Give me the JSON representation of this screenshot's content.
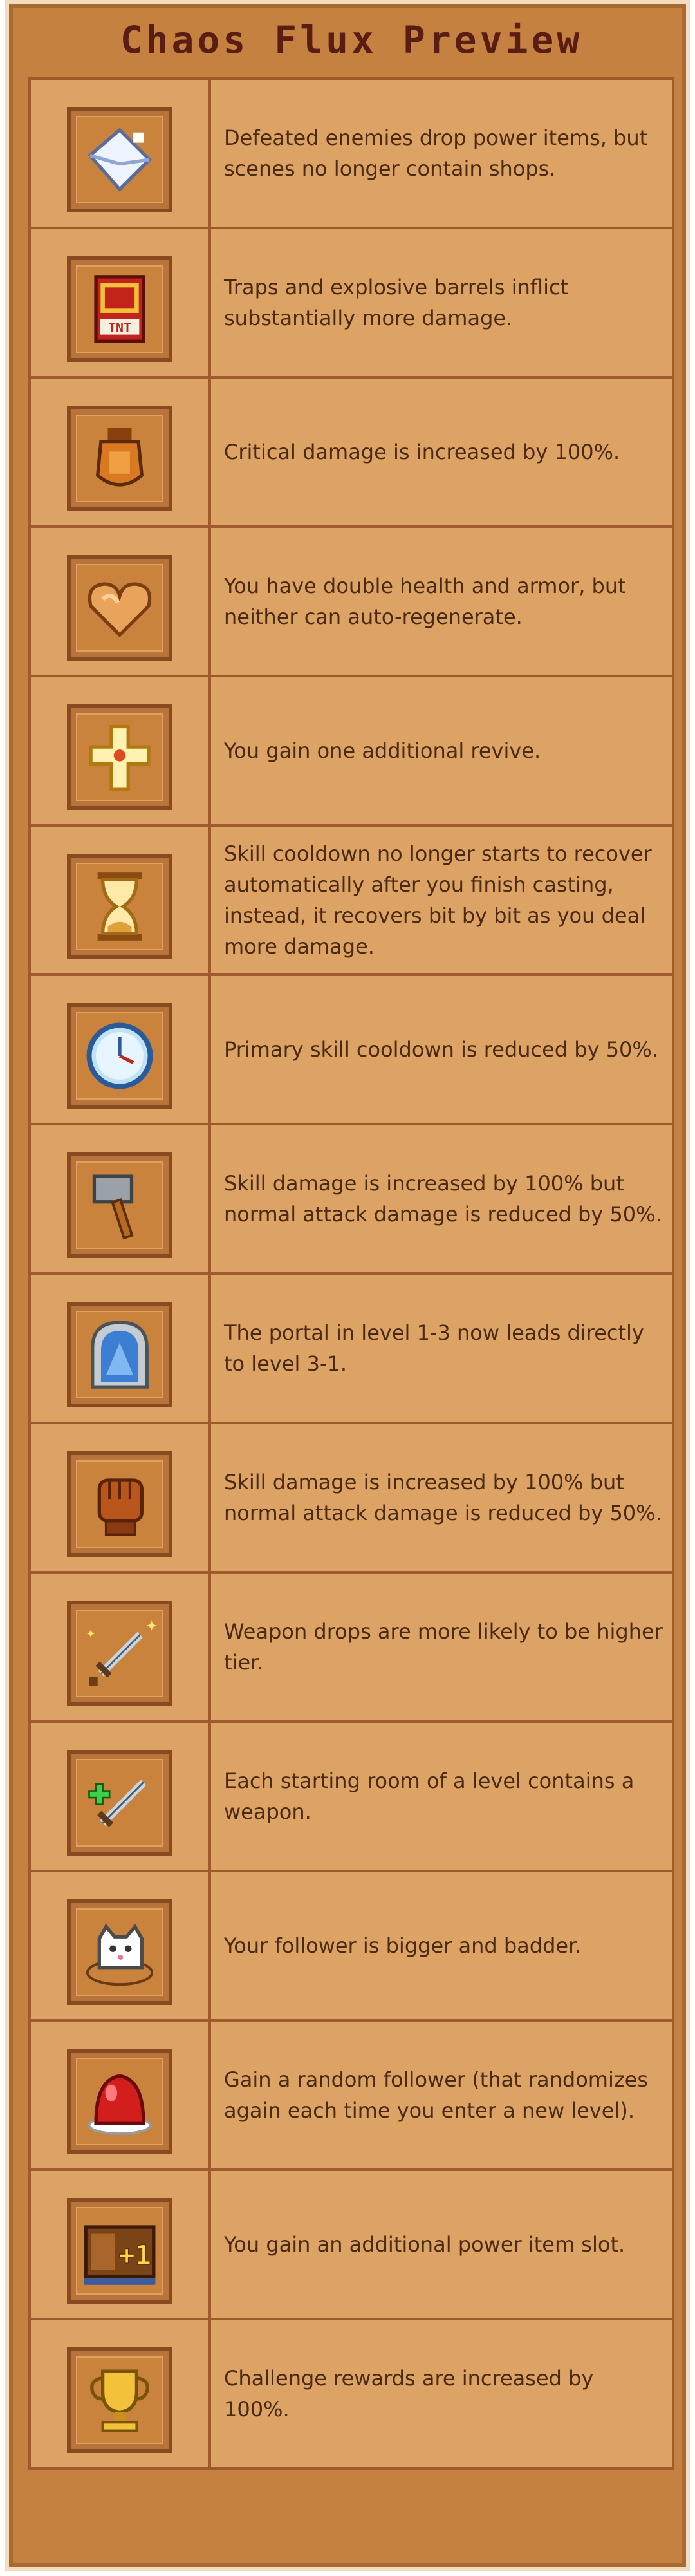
{
  "title": "Chaos Flux Preview",
  "rows": [
    {
      "icon": "envelope-icon",
      "text": "Defeated enemies drop power items, but scenes no longer contain shops."
    },
    {
      "icon": "tnt-icon",
      "text": "Traps and explosive barrels inflict substantially more damage."
    },
    {
      "icon": "shield-gauntlet-icon",
      "text": "Critical damage is increased by 100%."
    },
    {
      "icon": "heart-arm-icon",
      "text": "You have double health and armor, but neither can auto-regenerate."
    },
    {
      "icon": "holy-cross-icon",
      "text": "You gain one additional revive."
    },
    {
      "icon": "hourglass-icon",
      "text": "Skill cooldown no longer starts to recover automatically after you finish casting, instead, it recovers bit by bit as you deal more damage."
    },
    {
      "icon": "clock-icon",
      "text": "Primary skill cooldown is reduced by 50%."
    },
    {
      "icon": "hammer-icon",
      "text": "Skill damage is increased by 100% but normal attack damage is reduced by 50%."
    },
    {
      "icon": "portal-icon",
      "text": "The portal in level 1-3 now leads directly to level 3-1."
    },
    {
      "icon": "fist-icon",
      "text": "Skill damage is increased by 100% but normal attack damage is reduced by 50%."
    },
    {
      "icon": "sparkle-sword-icon",
      "text": "Weapon drops are more likely to be higher tier."
    },
    {
      "icon": "plus-sword-icon",
      "text": "Each starting room of a level contains a weapon."
    },
    {
      "icon": "cat-icon",
      "text": "Your follower is bigger and badder."
    },
    {
      "icon": "red-egg-icon",
      "text": "Gain a random follower (that randomizes again each time you enter a new level)."
    },
    {
      "icon": "plus-one-slot-icon",
      "text": "You gain an additional power item slot."
    },
    {
      "icon": "trophy-icon",
      "text": "Challenge rewards are increased by 100%."
    }
  ]
}
